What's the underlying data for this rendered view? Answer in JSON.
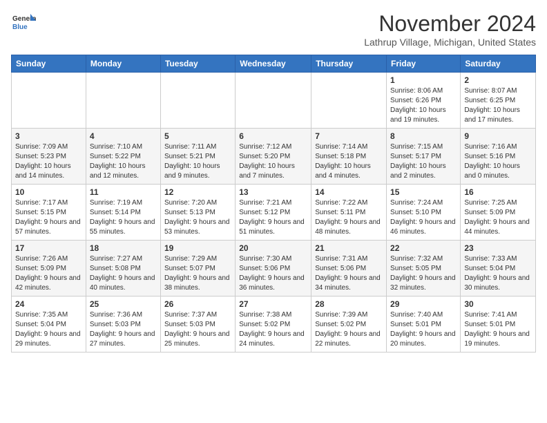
{
  "header": {
    "logo": {
      "line1": "General",
      "line2": "Blue"
    },
    "month": "November 2024",
    "location": "Lathrup Village, Michigan, United States"
  },
  "weekdays": [
    "Sunday",
    "Monday",
    "Tuesday",
    "Wednesday",
    "Thursday",
    "Friday",
    "Saturday"
  ],
  "weeks": [
    [
      {
        "day": "",
        "info": ""
      },
      {
        "day": "",
        "info": ""
      },
      {
        "day": "",
        "info": ""
      },
      {
        "day": "",
        "info": ""
      },
      {
        "day": "",
        "info": ""
      },
      {
        "day": "1",
        "info": "Sunrise: 8:06 AM\nSunset: 6:26 PM\nDaylight: 10 hours and 19 minutes."
      },
      {
        "day": "2",
        "info": "Sunrise: 8:07 AM\nSunset: 6:25 PM\nDaylight: 10 hours and 17 minutes."
      }
    ],
    [
      {
        "day": "3",
        "info": "Sunrise: 7:09 AM\nSunset: 5:23 PM\nDaylight: 10 hours and 14 minutes."
      },
      {
        "day": "4",
        "info": "Sunrise: 7:10 AM\nSunset: 5:22 PM\nDaylight: 10 hours and 12 minutes."
      },
      {
        "day": "5",
        "info": "Sunrise: 7:11 AM\nSunset: 5:21 PM\nDaylight: 10 hours and 9 minutes."
      },
      {
        "day": "6",
        "info": "Sunrise: 7:12 AM\nSunset: 5:20 PM\nDaylight: 10 hours and 7 minutes."
      },
      {
        "day": "7",
        "info": "Sunrise: 7:14 AM\nSunset: 5:18 PM\nDaylight: 10 hours and 4 minutes."
      },
      {
        "day": "8",
        "info": "Sunrise: 7:15 AM\nSunset: 5:17 PM\nDaylight: 10 hours and 2 minutes."
      },
      {
        "day": "9",
        "info": "Sunrise: 7:16 AM\nSunset: 5:16 PM\nDaylight: 10 hours and 0 minutes."
      }
    ],
    [
      {
        "day": "10",
        "info": "Sunrise: 7:17 AM\nSunset: 5:15 PM\nDaylight: 9 hours and 57 minutes."
      },
      {
        "day": "11",
        "info": "Sunrise: 7:19 AM\nSunset: 5:14 PM\nDaylight: 9 hours and 55 minutes."
      },
      {
        "day": "12",
        "info": "Sunrise: 7:20 AM\nSunset: 5:13 PM\nDaylight: 9 hours and 53 minutes."
      },
      {
        "day": "13",
        "info": "Sunrise: 7:21 AM\nSunset: 5:12 PM\nDaylight: 9 hours and 51 minutes."
      },
      {
        "day": "14",
        "info": "Sunrise: 7:22 AM\nSunset: 5:11 PM\nDaylight: 9 hours and 48 minutes."
      },
      {
        "day": "15",
        "info": "Sunrise: 7:24 AM\nSunset: 5:10 PM\nDaylight: 9 hours and 46 minutes."
      },
      {
        "day": "16",
        "info": "Sunrise: 7:25 AM\nSunset: 5:09 PM\nDaylight: 9 hours and 44 minutes."
      }
    ],
    [
      {
        "day": "17",
        "info": "Sunrise: 7:26 AM\nSunset: 5:09 PM\nDaylight: 9 hours and 42 minutes."
      },
      {
        "day": "18",
        "info": "Sunrise: 7:27 AM\nSunset: 5:08 PM\nDaylight: 9 hours and 40 minutes."
      },
      {
        "day": "19",
        "info": "Sunrise: 7:29 AM\nSunset: 5:07 PM\nDaylight: 9 hours and 38 minutes."
      },
      {
        "day": "20",
        "info": "Sunrise: 7:30 AM\nSunset: 5:06 PM\nDaylight: 9 hours and 36 minutes."
      },
      {
        "day": "21",
        "info": "Sunrise: 7:31 AM\nSunset: 5:06 PM\nDaylight: 9 hours and 34 minutes."
      },
      {
        "day": "22",
        "info": "Sunrise: 7:32 AM\nSunset: 5:05 PM\nDaylight: 9 hours and 32 minutes."
      },
      {
        "day": "23",
        "info": "Sunrise: 7:33 AM\nSunset: 5:04 PM\nDaylight: 9 hours and 30 minutes."
      }
    ],
    [
      {
        "day": "24",
        "info": "Sunrise: 7:35 AM\nSunset: 5:04 PM\nDaylight: 9 hours and 29 minutes."
      },
      {
        "day": "25",
        "info": "Sunrise: 7:36 AM\nSunset: 5:03 PM\nDaylight: 9 hours and 27 minutes."
      },
      {
        "day": "26",
        "info": "Sunrise: 7:37 AM\nSunset: 5:03 PM\nDaylight: 9 hours and 25 minutes."
      },
      {
        "day": "27",
        "info": "Sunrise: 7:38 AM\nSunset: 5:02 PM\nDaylight: 9 hours and 24 minutes."
      },
      {
        "day": "28",
        "info": "Sunrise: 7:39 AM\nSunset: 5:02 PM\nDaylight: 9 hours and 22 minutes."
      },
      {
        "day": "29",
        "info": "Sunrise: 7:40 AM\nSunset: 5:01 PM\nDaylight: 9 hours and 20 minutes."
      },
      {
        "day": "30",
        "info": "Sunrise: 7:41 AM\nSunset: 5:01 PM\nDaylight: 9 hours and 19 minutes."
      }
    ]
  ]
}
